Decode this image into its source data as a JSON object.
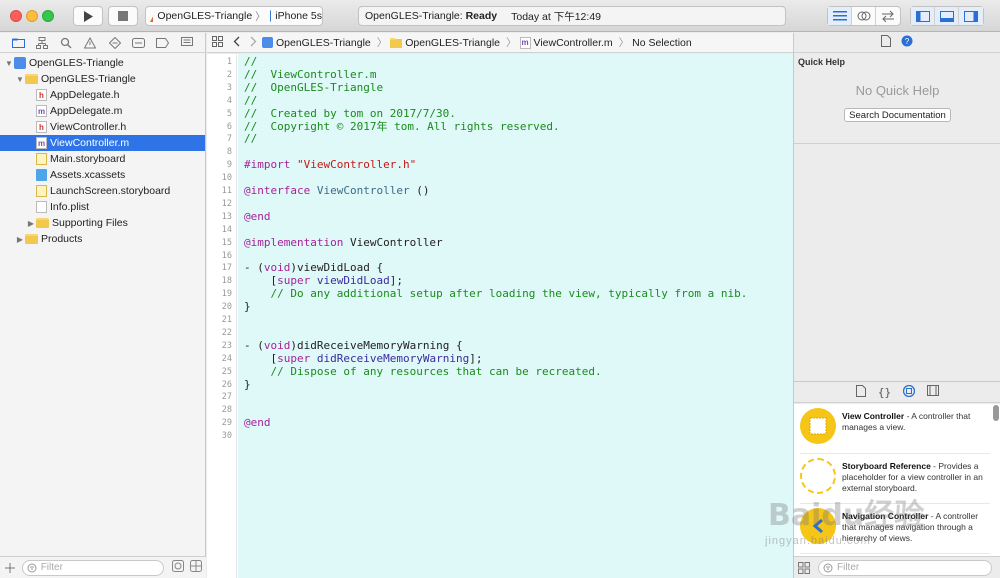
{
  "toolbar": {
    "scheme_target": "OpenGLES-Triangle",
    "scheme_device": "iPhone 5s",
    "status_project": "OpenGLES-Triangle",
    "status_state": "Ready",
    "status_time": "Today at 下午12:49"
  },
  "navigator": {
    "items": [
      {
        "label": "OpenGLES-Triangle",
        "indent": 0,
        "icon": "project-icon",
        "disclosure": "▼",
        "selected": false
      },
      {
        "label": "OpenGLES-Triangle",
        "indent": 1,
        "icon": "folder-icon",
        "disclosure": "▼",
        "selected": false
      },
      {
        "label": "AppDelegate.h",
        "indent": 2,
        "icon": "header-file-icon",
        "disclosure": "",
        "selected": false
      },
      {
        "label": "AppDelegate.m",
        "indent": 2,
        "icon": "source-file-icon",
        "disclosure": "",
        "selected": false
      },
      {
        "label": "ViewController.h",
        "indent": 2,
        "icon": "header-file-icon",
        "disclosure": "",
        "selected": false
      },
      {
        "label": "ViewController.m",
        "indent": 2,
        "icon": "source-file-icon",
        "disclosure": "",
        "selected": true
      },
      {
        "label": "Main.storyboard",
        "indent": 2,
        "icon": "storyboard-icon",
        "disclosure": "",
        "selected": false
      },
      {
        "label": "Assets.xcassets",
        "indent": 2,
        "icon": "asset-catalog-icon",
        "disclosure": "",
        "selected": false
      },
      {
        "label": "LaunchScreen.storyboard",
        "indent": 2,
        "icon": "storyboard-icon",
        "disclosure": "",
        "selected": false
      },
      {
        "label": "Info.plist",
        "indent": 2,
        "icon": "plist-icon",
        "disclosure": "",
        "selected": false
      },
      {
        "label": "Supporting Files",
        "indent": 2,
        "icon": "folder-icon",
        "disclosure": "▶",
        "selected": false
      },
      {
        "label": "Products",
        "indent": 1,
        "icon": "folder-icon",
        "disclosure": "▶",
        "selected": false
      }
    ],
    "filter_placeholder": "Filter"
  },
  "jumpbar": {
    "crumbs": [
      "OpenGLES-Triangle",
      "OpenGLES-Triangle",
      "ViewController.m",
      "No Selection"
    ]
  },
  "editor": {
    "lines": [
      {
        "n": "1",
        "kind": "comment",
        "text": "//"
      },
      {
        "n": "2",
        "kind": "comment",
        "text": "//  ViewController.m"
      },
      {
        "n": "3",
        "kind": "comment",
        "text": "//  OpenGLES-Triangle"
      },
      {
        "n": "4",
        "kind": "comment",
        "text": "//"
      },
      {
        "n": "5",
        "kind": "comment",
        "text": "//  Created by tom on 2017/7/30."
      },
      {
        "n": "6",
        "kind": "comment",
        "text": "//  Copyright © 2017年 tom. All rights reserved."
      },
      {
        "n": "7",
        "kind": "comment",
        "text": "//"
      },
      {
        "n": "8",
        "kind": "blank",
        "text": ""
      },
      {
        "n": "9",
        "kind": "import",
        "text": "#import \"ViewController.h\""
      },
      {
        "n": "10",
        "kind": "blank",
        "text": ""
      },
      {
        "n": "11",
        "kind": "interface",
        "text": "@interface ViewController ()"
      },
      {
        "n": "12",
        "kind": "blank",
        "text": ""
      },
      {
        "n": "13",
        "kind": "end",
        "text": "@end"
      },
      {
        "n": "14",
        "kind": "blank",
        "text": ""
      },
      {
        "n": "15",
        "kind": "implementation",
        "text": "@implementation ViewController"
      },
      {
        "n": "16",
        "kind": "blank",
        "text": ""
      },
      {
        "n": "17",
        "kind": "method",
        "text": "- (void)viewDidLoad {"
      },
      {
        "n": "18",
        "kind": "supercall",
        "text": "    [super viewDidLoad];"
      },
      {
        "n": "19",
        "kind": "comment",
        "text": "    // Do any additional setup after loading the view, typically from a nib."
      },
      {
        "n": "20",
        "kind": "plain",
        "text": "}"
      },
      {
        "n": "21",
        "kind": "blank",
        "text": ""
      },
      {
        "n": "22",
        "kind": "blank",
        "text": ""
      },
      {
        "n": "23",
        "kind": "method",
        "text": "- (void)didReceiveMemoryWarning {"
      },
      {
        "n": "24",
        "kind": "supercall",
        "text": "    [super didReceiveMemoryWarning];"
      },
      {
        "n": "25",
        "kind": "comment",
        "text": "    // Dispose of any resources that can be recreated."
      },
      {
        "n": "26",
        "kind": "plain",
        "text": "}"
      },
      {
        "n": "27",
        "kind": "blank",
        "text": ""
      },
      {
        "n": "28",
        "kind": "blank",
        "text": ""
      },
      {
        "n": "29",
        "kind": "end",
        "text": "@end"
      },
      {
        "n": "30",
        "kind": "blank",
        "text": ""
      }
    ]
  },
  "utilities": {
    "quick_help_title": "Quick Help",
    "no_quick_help": "No Quick Help",
    "search_documentation": "Search Documentation",
    "library": [
      {
        "name": "View Controller",
        "desc": " - A controller that manages a view.",
        "color": "#f5c518",
        "style": "solid"
      },
      {
        "name": "Storyboard Reference",
        "desc": " - Provides a placeholder for a view controller in an external storyboard.",
        "color": "#f5c518",
        "style": "dashed"
      },
      {
        "name": "Navigation Controller",
        "desc": " - A controller that manages navigation through a hierarchy of views.",
        "color": "#f5c518",
        "style": "nav"
      }
    ],
    "filter_placeholder": "Filter"
  },
  "watermark": {
    "text": "Baidu经验",
    "sub": "jingyan.baidu.com"
  },
  "colors": {
    "selection": "#2f74e6",
    "editor_bg": "#dff8f8",
    "comment": "#1a8c1a",
    "keyword": "#a6239a",
    "string": "#c41a16"
  }
}
